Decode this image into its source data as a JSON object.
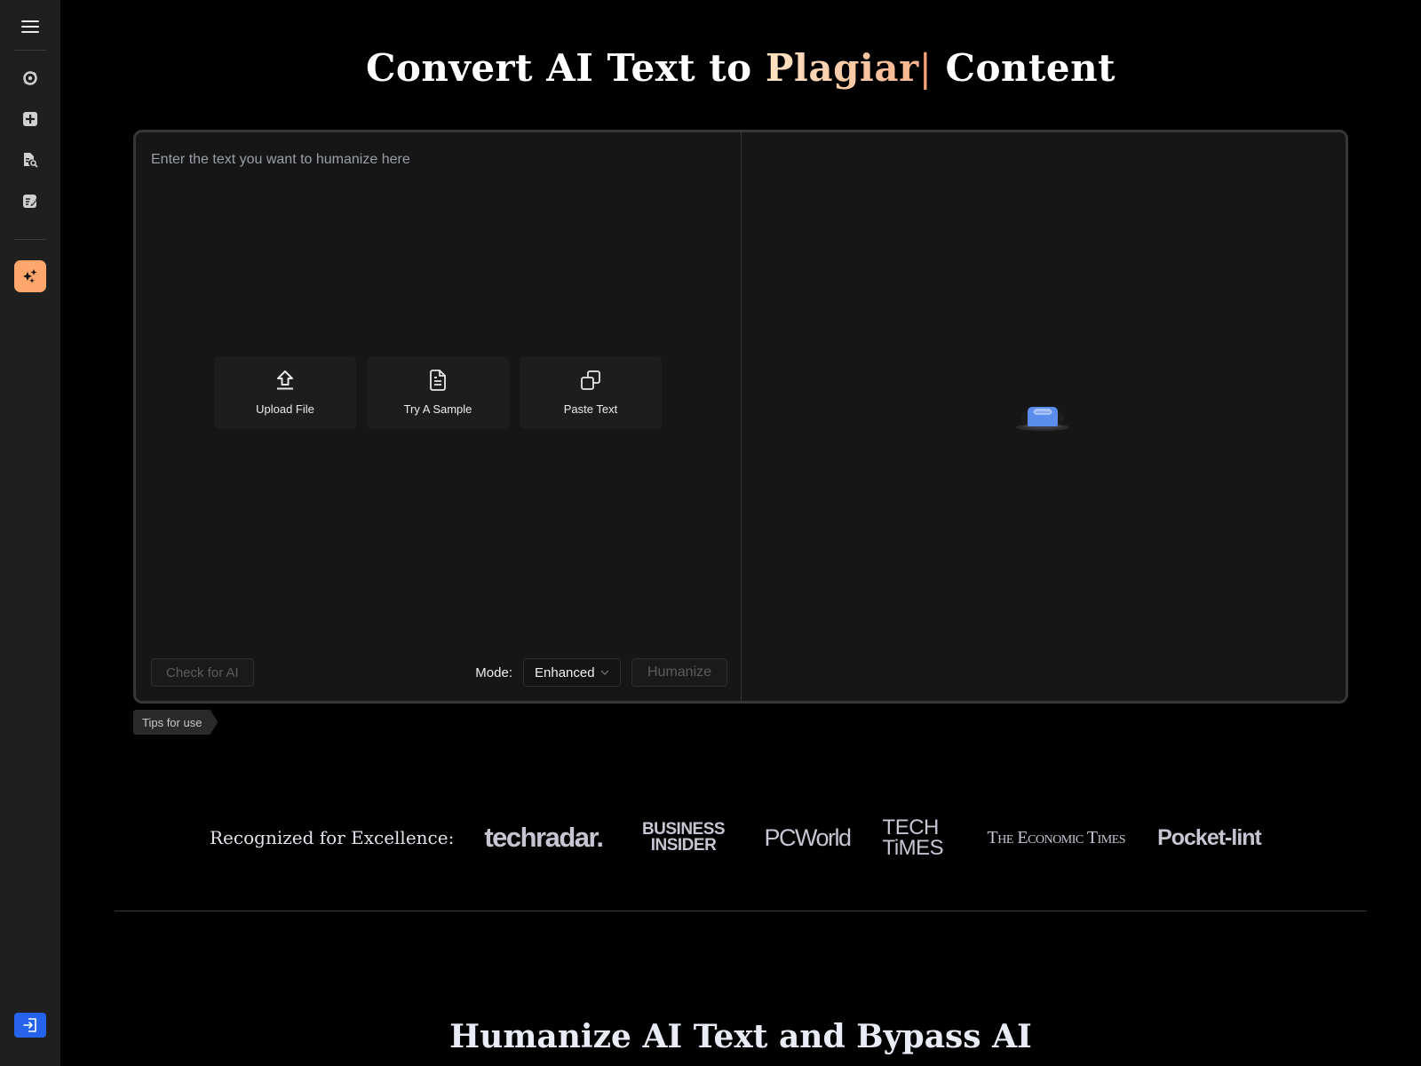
{
  "sidebar": {
    "menu_icon": "hamburger-menu-icon",
    "items": [
      {
        "icon": "refresh-cycle-icon",
        "name": "paraphraser"
      },
      {
        "icon": "plus-square-icon",
        "name": "create"
      },
      {
        "icon": "document-search-icon",
        "name": "plagiarism-checker"
      },
      {
        "icon": "document-edit-icon",
        "name": "editor"
      }
    ],
    "active_item": {
      "icon": "sparkles-icon",
      "name": "ai-humanizer",
      "color": "#fda76c"
    },
    "login_icon": "login-icon",
    "login_color": "#2563eb"
  },
  "hero": {
    "title_prefix": "Convert AI Text to ",
    "title_accent": "Plagiar",
    "title_caret": "|",
    "title_suffix": " Content"
  },
  "editor": {
    "input_placeholder": "Enter the text you want to humanize here",
    "actions": [
      {
        "label": "Upload File",
        "icon": "upload-icon"
      },
      {
        "label": "Try A Sample",
        "icon": "document-icon"
      },
      {
        "label": "Paste Text",
        "icon": "copy-icon"
      }
    ],
    "check_ai_label": "Check for AI",
    "mode_label": "Mode:",
    "mode_value": "Enhanced",
    "humanize_label": "Humanize",
    "empty_state_icon": "empty-inbox-icon"
  },
  "tips_label": "Tips for use",
  "recognized": {
    "label": "Recognized for Excellence:",
    "logos": [
      "techradar.",
      "BUSINESS INSIDER",
      "PCWorld",
      "TECH TiMES",
      "The Economic Times",
      "Pocket-lint"
    ]
  },
  "section2": {
    "title": "Humanize AI Text and Bypass AI"
  }
}
